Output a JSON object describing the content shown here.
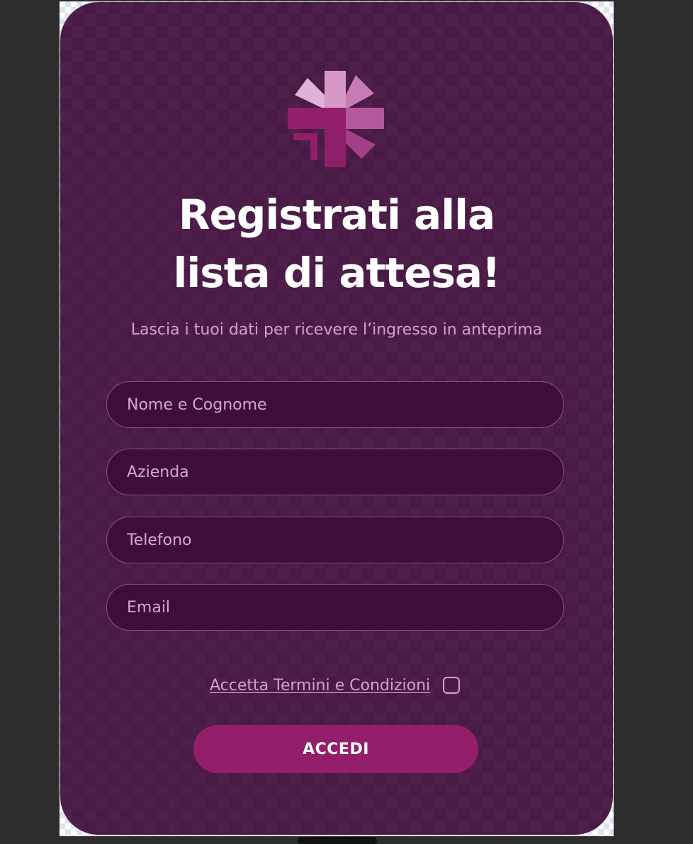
{
  "colors": {
    "background": "#2d2d2d",
    "card": "#4a1a46",
    "input_fill": "#3f0d3b",
    "input_border": "#8a4f86",
    "muted_text": "#d6a0cd",
    "button": "#931f6a",
    "logo_light": "#dda8cf",
    "logo_mid": "#c77bb4",
    "logo_dark": "#931f6a"
  },
  "logo": {
    "icon": "asterisk-arrow-logo-icon"
  },
  "header": {
    "title_line1": "Registrati alla",
    "title_line2": "lista di attesa!",
    "subtitle": "Lascia i tuoi dati per ricevere l’ingresso in anteprima"
  },
  "form": {
    "name_placeholder": "Nome e Cognome",
    "company_placeholder": "Azienda",
    "phone_placeholder": "Telefono",
    "email_placeholder": "Email",
    "terms_label": "Accetta Termini e Condizioni",
    "terms_checked": false,
    "submit_label": "ACCEDI"
  }
}
